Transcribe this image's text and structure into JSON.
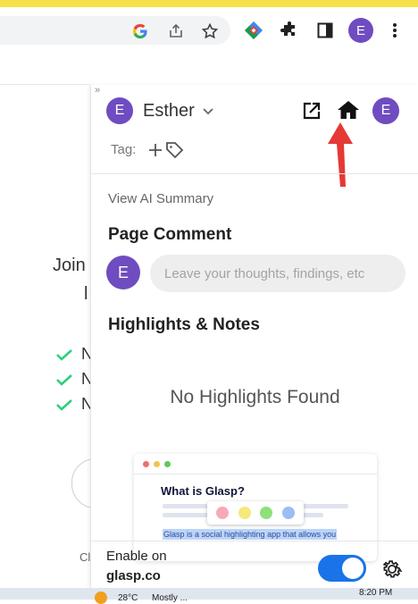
{
  "browser": {
    "toolbar_icons": [
      "google-icon",
      "share-icon",
      "star-icon",
      "extension-colorful-icon",
      "puzzle-icon",
      "sidepanel-icon",
      "profile-avatar",
      "kebab-menu-icon"
    ],
    "profile_initial": "E"
  },
  "page_left": {
    "heading_line1": "Join",
    "heading_line2": "l",
    "checks": [
      "N",
      "N",
      "N"
    ],
    "footer_fragment": "Cl"
  },
  "panel": {
    "user_initial": "E",
    "user_name": "Esther",
    "tag_label": "Tag:",
    "view_ai_summary": "View AI Summary",
    "page_comment_title": "Page Comment",
    "comment_placeholder": "Leave your thoughts, findings, etc",
    "highlights_title": "Highlights & Notes",
    "empty_state": "No Highlights Found",
    "preview_card": {
      "title": "What is Glasp?",
      "highlight_text": "Glasp is a social highlighting app that allows you",
      "swatches": [
        "#f7a9b9",
        "#f5e97a",
        "#8ee07a",
        "#9bbcf5"
      ]
    },
    "enable_label": "Enable on",
    "enable_domain": "glasp.co",
    "enable_toggle_on": true
  },
  "taskbar": {
    "weather_temp": "28°C",
    "weather_text": "Mostly ...",
    "time": "8:20 PM"
  },
  "colors": {
    "accent_purple": "#6f4cc0",
    "toggle_blue": "#1a73e8",
    "annotation_red": "#e53935",
    "check_green": "#2bd07d"
  }
}
